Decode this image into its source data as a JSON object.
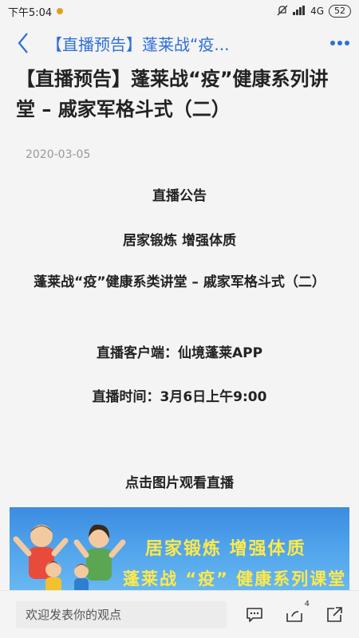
{
  "status": {
    "time": "下午5:04",
    "network": "4G",
    "battery": "52"
  },
  "nav": {
    "title": "【直播预告】蓬莱战“疫..."
  },
  "article": {
    "title": "【直播预告】蓬莱战“疫”健康系列讲堂 – 戚家军格斗式（二）",
    "date": "2020-03-05",
    "paragraphs": {
      "p1": "直播公告",
      "p2": "居家锻炼 增强体质",
      "p3": "蓬莱战“疫”健康系类讲堂 – 戚家军格斗式（二）",
      "p4": "直播客户端：仙境蓬莱APP",
      "p5": "直播时间：3月6日上午9:00",
      "p6": "点击图片观看直播"
    },
    "banner": {
      "line1": "居家锻炼  增强体质",
      "line2": "蓬莱战 “疫” 健康系列课堂"
    }
  },
  "comment_bar": {
    "placeholder": "欢迎发表你的观点",
    "share_count": "4"
  },
  "colors": {
    "accent": "#2f6fd8",
    "banner_text": "#ffe94a"
  }
}
